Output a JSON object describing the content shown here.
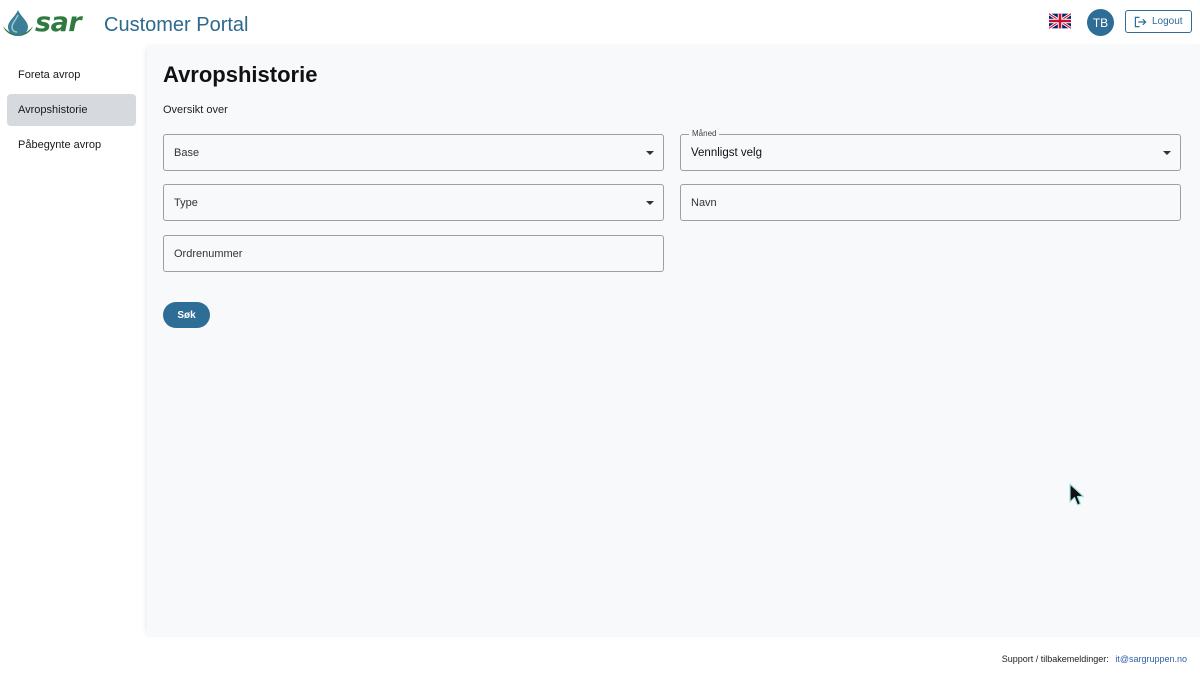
{
  "header": {
    "logo_text": "sar",
    "portal_title": "Customer Portal",
    "avatar_initials": "TB",
    "logout_label": "Logout"
  },
  "sidebar": {
    "items": [
      {
        "label": "Foreta avrop",
        "active": false
      },
      {
        "label": "Avropshistorie",
        "active": true
      },
      {
        "label": "Påbegynte avrop",
        "active": false
      }
    ]
  },
  "main": {
    "title": "Avropshistorie",
    "subtitle": "Oversikt over",
    "filters": {
      "base": {
        "placeholder": "Base"
      },
      "maned": {
        "label": "Måned",
        "value": "Vennligst velg"
      },
      "type": {
        "placeholder": "Type"
      },
      "navn": {
        "placeholder": "Navn"
      },
      "ordrenummer": {
        "placeholder": "Ordrenummer"
      }
    },
    "search_label": "Søk"
  },
  "footer": {
    "support_text": "Support / tilbakemeldinger:",
    "support_email": "it@sargruppen.no"
  },
  "colors": {
    "primary": "#2e6d96",
    "brand_green": "#2f7a3f",
    "title_blue": "#2d6a8c",
    "sidebar_active": "#d6dade",
    "main_bg": "#f8f9fa"
  }
}
